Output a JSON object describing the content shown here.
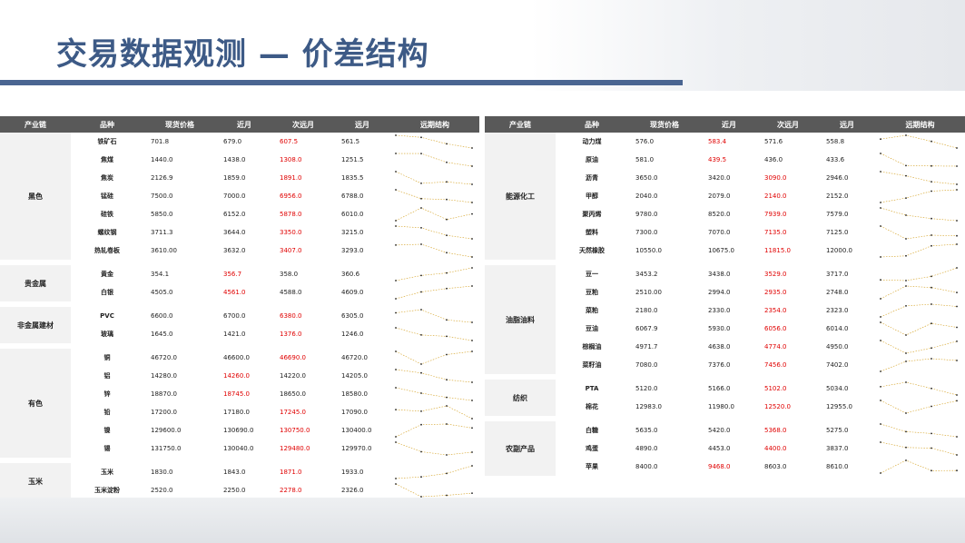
{
  "title": "交易数据观测 — 价差结构",
  "colors": {
    "accent": "#3d5a86",
    "header_bg": "#595959",
    "red": "#e00000",
    "spark": "#d4a020"
  },
  "headers": [
    "产业链",
    "品种",
    "现货价格",
    "近月",
    "次远月",
    "远月",
    "远期结构"
  ],
  "left": [
    {
      "chain": "黑色",
      "rows": [
        {
          "name": "铁矿石",
          "vals": [
            "701.8",
            "679.0",
            "607.5",
            "561.5"
          ],
          "red": [
            2
          ]
        },
        {
          "name": "焦煤",
          "vals": [
            "1440.0",
            "1438.0",
            "1308.0",
            "1251.5"
          ],
          "red": [
            2
          ]
        },
        {
          "name": "焦炭",
          "vals": [
            "2126.9",
            "1859.0",
            "1891.0",
            "1835.5"
          ],
          "red": [
            2
          ]
        },
        {
          "name": "锰硅",
          "vals": [
            "7500.0",
            "7000.0",
            "6956.0",
            "6788.0"
          ],
          "red": [
            2
          ]
        },
        {
          "name": "硅铁",
          "vals": [
            "5850.0",
            "6152.0",
            "5878.0",
            "6010.0"
          ],
          "red": [
            2
          ]
        },
        {
          "name": "螺纹钢",
          "vals": [
            "3711.3",
            "3644.0",
            "3350.0",
            "3215.0"
          ],
          "red": [
            2
          ]
        },
        {
          "name": "热轧卷板",
          "vals": [
            "3610.00",
            "3632.0",
            "3407.0",
            "3293.0"
          ],
          "red": [
            2
          ]
        }
      ]
    },
    {
      "chain": "贵金属",
      "rows": [
        {
          "name": "黄金",
          "vals": [
            "354.1",
            "356.7",
            "358.0",
            "360.6"
          ],
          "red": [
            1
          ]
        },
        {
          "name": "白银",
          "vals": [
            "4505.0",
            "4561.0",
            "4588.0",
            "4609.0"
          ],
          "red": [
            1
          ]
        }
      ]
    },
    {
      "chain": "非金属建材",
      "rows": [
        {
          "name": "PVC",
          "vals": [
            "6600.0",
            "6700.0",
            "6380.0",
            "6305.0"
          ],
          "red": [
            2
          ]
        },
        {
          "name": "玻璃",
          "vals": [
            "1645.0",
            "1421.0",
            "1376.0",
            "1246.0"
          ],
          "red": [
            2
          ]
        }
      ]
    },
    {
      "chain": "有色",
      "rows": [
        {
          "name": "铜",
          "vals": [
            "46720.0",
            "46600.0",
            "46690.0",
            "46720.0"
          ],
          "red": [
            2
          ]
        },
        {
          "name": "铝",
          "vals": [
            "14280.0",
            "14260.0",
            "14220.0",
            "14205.0"
          ],
          "red": [
            1
          ]
        },
        {
          "name": "锌",
          "vals": [
            "18870.0",
            "18745.0",
            "18650.0",
            "18580.0"
          ],
          "red": [
            1
          ]
        },
        {
          "name": "铅",
          "vals": [
            "17200.0",
            "17180.0",
            "17245.0",
            "17090.0"
          ],
          "red": [
            2
          ]
        },
        {
          "name": "镍",
          "vals": [
            "129600.0",
            "130690.0",
            "130750.0",
            "130400.0"
          ],
          "red": [
            2
          ]
        },
        {
          "name": "锡",
          "vals": [
            "131750.0",
            "130040.0",
            "129480.0",
            "129970.0"
          ],
          "red": [
            2
          ]
        }
      ]
    },
    {
      "chain": "玉米",
      "rows": [
        {
          "name": "玉米",
          "vals": [
            "1830.0",
            "1843.0",
            "1871.0",
            "1933.0"
          ],
          "red": [
            2
          ]
        },
        {
          "name": "玉米淀粉",
          "vals": [
            "2520.0",
            "2250.0",
            "2278.0",
            "2326.0"
          ],
          "red": [
            2
          ]
        }
      ]
    }
  ],
  "right": [
    {
      "chain": "能源化工",
      "rows": [
        {
          "name": "动力煤",
          "vals": [
            "576.0",
            "583.4",
            "571.6",
            "558.8"
          ],
          "red": [
            1
          ]
        },
        {
          "name": "原油",
          "vals": [
            "581.0",
            "439.5",
            "436.0",
            "433.6"
          ],
          "red": [
            1
          ]
        },
        {
          "name": "沥青",
          "vals": [
            "3650.0",
            "3420.0",
            "3090.0",
            "2946.0"
          ],
          "red": [
            2
          ]
        },
        {
          "name": "甲醇",
          "vals": [
            "2040.0",
            "2079.0",
            "2140.0",
            "2152.0"
          ],
          "red": [
            2
          ]
        },
        {
          "name": "聚丙烯",
          "vals": [
            "9780.0",
            "8520.0",
            "7939.0",
            "7579.0"
          ],
          "red": [
            2
          ]
        },
        {
          "name": "塑料",
          "vals": [
            "7300.0",
            "7070.0",
            "7135.0",
            "7125.0"
          ],
          "red": [
            2
          ]
        },
        {
          "name": "天然橡胶",
          "vals": [
            "10550.0",
            "10675.0",
            "11815.0",
            "12000.0"
          ],
          "red": [
            2
          ]
        }
      ]
    },
    {
      "chain": "油脂油料",
      "rows": [
        {
          "name": "豆一",
          "vals": [
            "3453.2",
            "3438.0",
            "3529.0",
            "3717.0"
          ],
          "red": [
            2
          ]
        },
        {
          "name": "豆粕",
          "vals": [
            "2510.00",
            "2994.0",
            "2935.0",
            "2748.0"
          ],
          "red": [
            2
          ]
        },
        {
          "name": "菜粕",
          "vals": [
            "2180.0",
            "2330.0",
            "2354.0",
            "2323.0"
          ],
          "red": [
            2
          ]
        },
        {
          "name": "豆油",
          "vals": [
            "6067.9",
            "5930.0",
            "6056.0",
            "6014.0"
          ],
          "red": [
            2
          ]
        },
        {
          "name": "棕榈油",
          "vals": [
            "4971.7",
            "4638.0",
            "4774.0",
            "4950.0"
          ],
          "red": [
            2
          ]
        },
        {
          "name": "菜籽油",
          "vals": [
            "7080.0",
            "7376.0",
            "7456.0",
            "7402.0"
          ],
          "red": [
            2
          ]
        }
      ]
    },
    {
      "chain": "纺织",
      "rows": [
        {
          "name": "PTA",
          "vals": [
            "5120.0",
            "5166.0",
            "5102.0",
            "5034.0"
          ],
          "red": [
            2
          ]
        },
        {
          "name": "棉花",
          "vals": [
            "12983.0",
            "11980.0",
            "12520.0",
            "12955.0"
          ],
          "red": [
            2
          ]
        }
      ]
    },
    {
      "chain": "农副产品",
      "rows": [
        {
          "name": "白糖",
          "vals": [
            "5635.0",
            "5420.0",
            "5368.0",
            "5275.0"
          ],
          "red": [
            2
          ]
        },
        {
          "name": "鸡蛋",
          "vals": [
            "4890.0",
            "4453.0",
            "4400.0",
            "3837.0"
          ],
          "red": [
            2
          ]
        },
        {
          "name": "苹果",
          "vals": [
            "8400.0",
            "9468.0",
            "8603.0",
            "8610.0"
          ],
          "red": [
            1
          ]
        }
      ]
    }
  ]
}
